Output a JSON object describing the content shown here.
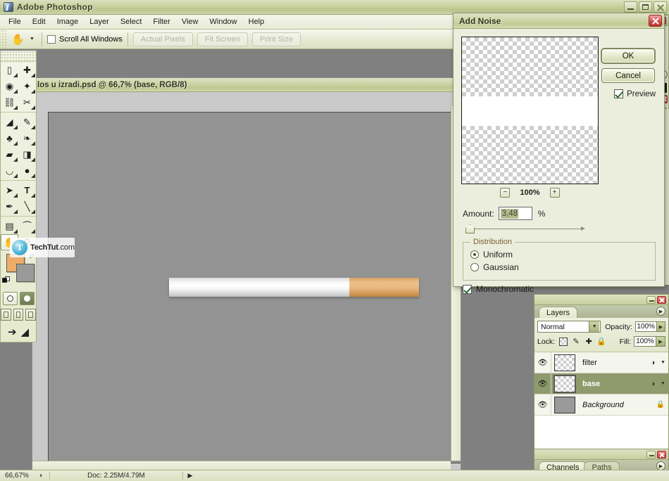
{
  "app": {
    "title": "Adobe Photoshop",
    "logo_icon": "photoshop-logo-icon",
    "window_controls": {
      "minimize": "−",
      "maximize": "□",
      "close": "×"
    }
  },
  "menubar": {
    "items": [
      "File",
      "Edit",
      "Image",
      "Layer",
      "Select",
      "Filter",
      "View",
      "Window",
      "Help"
    ]
  },
  "options_bar": {
    "active_tool_icon": "hand-tool-icon",
    "tool_preset_arrow": "▾",
    "scroll_all_windows": {
      "label": "Scroll All Windows",
      "checked": false
    },
    "buttons": [
      "Actual Pixels",
      "Fit Screen",
      "Print Size"
    ]
  },
  "toolbox": {
    "tools": [
      {
        "icon": "marquee-rect-icon",
        "glyph": "▭",
        "selected": false
      },
      {
        "icon": "move-tool-icon",
        "glyph": "✛",
        "selected": false
      },
      {
        "icon": "lasso-icon",
        "glyph": "✎",
        "selected": false
      },
      {
        "icon": "magic-wand-icon",
        "glyph": "✦",
        "selected": false
      },
      {
        "icon": "crop-icon",
        "glyph": "✄",
        "selected": false
      },
      {
        "icon": "slice-icon",
        "glyph": "✂",
        "selected": false
      },
      {
        "icon": "healing-brush-icon",
        "glyph": "◣",
        "selected": false
      },
      {
        "icon": "brush-icon",
        "glyph": "✏",
        "selected": false
      },
      {
        "icon": "clone-stamp-icon",
        "glyph": "♣",
        "selected": false
      },
      {
        "icon": "history-brush-icon",
        "glyph": "❧",
        "selected": false
      },
      {
        "icon": "eraser-icon",
        "glyph": "◰",
        "selected": false
      },
      {
        "icon": "gradient-icon",
        "glyph": "◨",
        "selected": false
      },
      {
        "icon": "blur-icon",
        "glyph": "◠",
        "selected": false
      },
      {
        "icon": "dodge-icon",
        "glyph": "⬤",
        "selected": false
      },
      {
        "icon": "path-selection-icon",
        "glyph": "➤",
        "selected": false
      },
      {
        "icon": "type-tool-icon",
        "glyph": "T",
        "selected": false
      },
      {
        "icon": "pen-tool-icon",
        "glyph": "✒",
        "selected": false
      },
      {
        "icon": "line-tool-icon",
        "glyph": "╲",
        "selected": false
      },
      {
        "icon": "notes-icon",
        "glyph": "▤",
        "selected": false
      },
      {
        "icon": "eyedropper-icon",
        "glyph": "⌇",
        "selected": false
      },
      {
        "icon": "hand-tool-icon",
        "glyph": "✋",
        "selected": true
      },
      {
        "icon": "zoom-tool-icon",
        "glyph": "🔍",
        "selected": false
      }
    ],
    "foreground_color": "#eeac6a",
    "background_color": "#9a9a9a",
    "reset_colors_icon": "reset-colors-icon",
    "swap_colors_icon": "swap-colors-icon",
    "quick_mask": [
      "standard-mode-icon",
      "quick-mask-mode-icon"
    ],
    "screen_modes": [
      "standard-screen-icon",
      "full-screen-menubar-icon",
      "full-screen-icon"
    ],
    "jump_to": [
      "jump-to-imageready-icon",
      "edit-in-imageready-icon"
    ]
  },
  "document": {
    "title": "los u izradi.psd @ 66,7% (base, RGB/8)",
    "canvas_background": "#939393",
    "artwork": {
      "name": "cigarette",
      "body_color": "#ffffff",
      "filter_color": "#e0a96a"
    }
  },
  "status_bar": {
    "zoom": "66,67%",
    "preview_icon": "preview-icon",
    "doc_size": "Doc: 2.25M/4.79M",
    "arrow_icon": "play-arrow-icon"
  },
  "dialog": {
    "title": "Add Noise",
    "close_icon": "close-icon",
    "preview_zoom": "100%",
    "zoom_out_label": "−",
    "zoom_in_label": "+",
    "ok_label": "OK",
    "cancel_label": "Cancel",
    "preview_checkbox": {
      "label": "Preview",
      "checked": true
    },
    "amount": {
      "label": "Amount:",
      "value": "3,48",
      "unit": "%",
      "slider_position_pct": 3
    },
    "distribution": {
      "legend": "Distribution",
      "options": [
        {
          "label": "Uniform",
          "selected": true
        },
        {
          "label": "Gaussian",
          "selected": false
        }
      ]
    },
    "monochromatic": {
      "label": "Monochromatic",
      "checked": true
    }
  },
  "layers_palette": {
    "tab_label": "Layers",
    "menu_icon": "palette-menu-icon",
    "minimize_icon": "minimize-icon",
    "close_icon": "close-icon",
    "blend_mode": "Normal",
    "blend_dropdown_icon": "chevron-down-icon",
    "opacity_label": "Opacity:",
    "opacity_value": "100%",
    "lock_label": "Lock:",
    "lock_icons": [
      "lock-transparency-icon",
      "lock-pixels-icon",
      "lock-position-icon",
      "lock-all-icon"
    ],
    "fill_label": "Fill:",
    "fill_value": "100%",
    "layers": [
      {
        "name": "filter",
        "visible": true,
        "selected": false,
        "italic": false,
        "thumb": "transparent",
        "has_fx": true,
        "locked": false
      },
      {
        "name": "base",
        "visible": true,
        "selected": true,
        "italic": false,
        "thumb": "transparent",
        "has_fx": true,
        "locked": false
      },
      {
        "name": "Background",
        "visible": true,
        "selected": false,
        "italic": true,
        "thumb": "solid-gray",
        "has_fx": false,
        "locked": true
      }
    ],
    "footer_icons": [
      "link-layers-icon",
      "layer-style-icon",
      "layer-mask-icon",
      "adjustment-layer-icon",
      "new-group-icon",
      "new-layer-icon",
      "delete-layer-icon"
    ]
  },
  "channels_palette": {
    "tabs": [
      {
        "label": "Channels",
        "active": true
      },
      {
        "label": "Paths",
        "active": false
      }
    ],
    "menu_icon": "palette-menu-icon",
    "minimize_icon": "minimize-icon",
    "close_icon": "close-icon"
  },
  "watermark": {
    "logo": "T",
    "text": "TechTut",
    "suffix": ".com"
  },
  "colors": {
    "chrome_green": "#c8cf9d",
    "panel_bg": "#eceedd",
    "selection_green": "#8f9b6d",
    "canvas_gray": "#939393",
    "close_red": "#c94040"
  }
}
